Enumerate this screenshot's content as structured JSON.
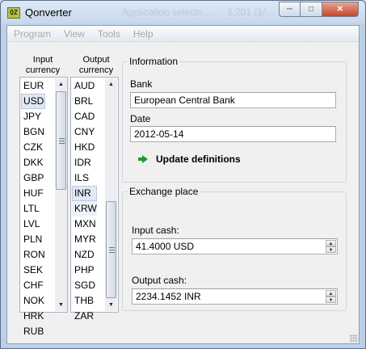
{
  "window": {
    "title": "Qonverter",
    "icon_text": "QZ",
    "ghost_title_1": "Application selecto...",
    "ghost_title_2": "2,201 (1/...",
    "buttons": {
      "minimize": "minimize-icon",
      "maximize": "maximize-icon",
      "close": "close-icon"
    }
  },
  "menu": [
    "Program",
    "View",
    "Tools",
    "Help"
  ],
  "input_currency": {
    "header_line1": "Input",
    "header_line2": "currency",
    "items": [
      "EUR",
      "USD",
      "JPY",
      "BGN",
      "CZK",
      "DKK",
      "GBP",
      "HUF",
      "LTL",
      "LVL",
      "PLN",
      "RON",
      "SEK",
      "CHF",
      "NOK",
      "HRK",
      "RUB"
    ],
    "selected": "USD"
  },
  "output_currency": {
    "header_line1": "Output",
    "header_line2": "currency",
    "items": [
      "AUD",
      "BRL",
      "CAD",
      "CNY",
      "HKD",
      "IDR",
      "ILS",
      "INR",
      "KRW",
      "MXN",
      "MYR",
      "NZD",
      "PHP",
      "SGD",
      "THB",
      "ZAR"
    ],
    "selected": "INR",
    "hovered": "KRW"
  },
  "information": {
    "title": "Information",
    "bank_label": "Bank",
    "bank_value": "European Central Bank",
    "date_label": "Date",
    "date_value": "2012-05-14",
    "update_label": "Update definitions"
  },
  "exchange": {
    "title": "Exchange place",
    "input_label": "Input cash:",
    "input_value": "41.4000 USD",
    "output_label": "Output cash:",
    "output_value": "2234.1452 INR"
  },
  "colors": {
    "accent_green": "#1f9a2b",
    "titlebar": "#c9daed",
    "client_bg": "#f0f0f0"
  }
}
